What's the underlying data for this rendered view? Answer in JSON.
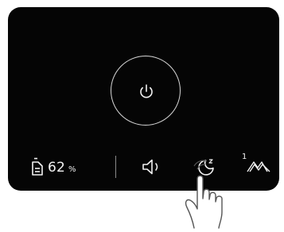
{
  "filter": {
    "value": "62",
    "unit": "%",
    "icon": "filter-icon"
  },
  "controls": {
    "power_icon": "power-icon",
    "sound_icon": "speaker-icon",
    "sleep_icon": "sleep-moon-icon",
    "speed_icon": "fan-speed-icon",
    "speed_level": "1"
  },
  "colors": {
    "panel_background": "#050505",
    "foreground": "#f2f2f2",
    "ring": "#d8d8d8"
  }
}
